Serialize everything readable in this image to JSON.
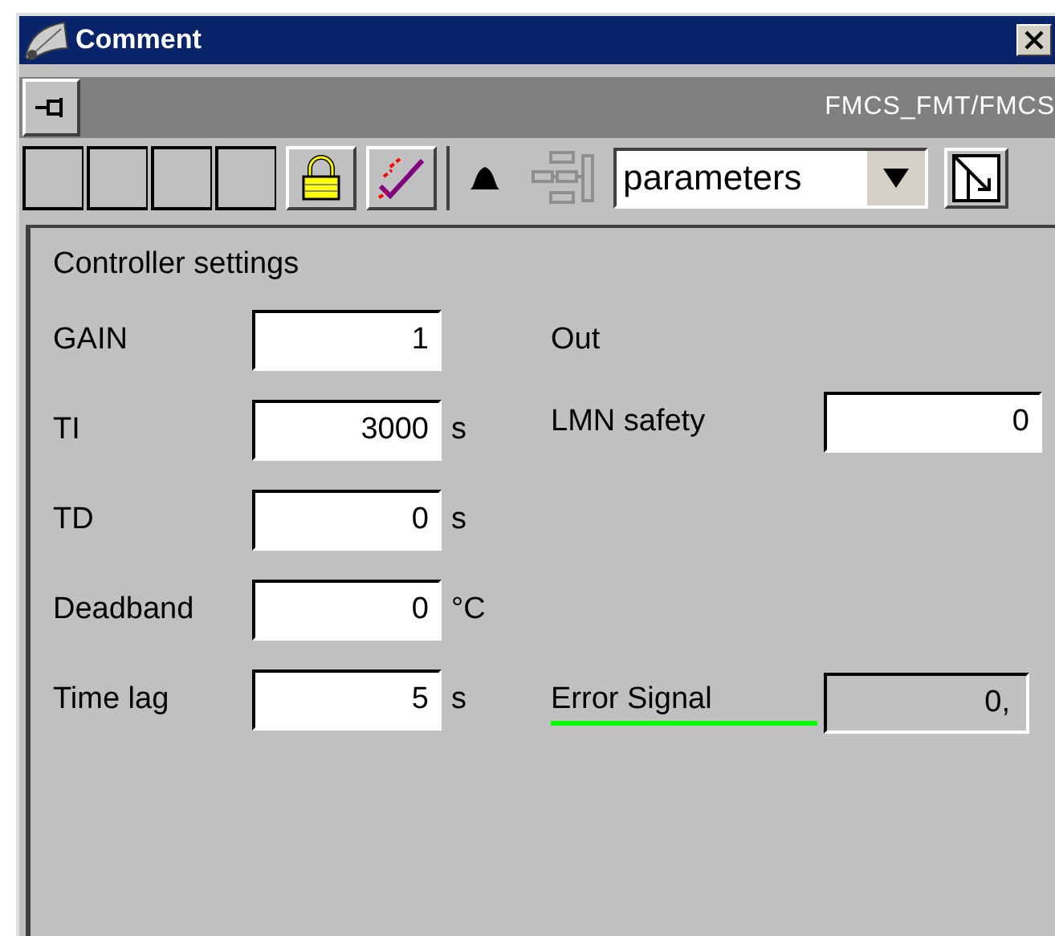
{
  "window": {
    "title": "Comment"
  },
  "header": {
    "path": "FMCS_FMT/FMCS"
  },
  "toolbar": [
    {
      "kind": "blank"
    },
    {
      "kind": "blank"
    },
    {
      "kind": "blank"
    },
    {
      "kind": "blank"
    },
    {
      "kind": "lock"
    },
    {
      "kind": "check"
    },
    {
      "kind": "bell"
    },
    {
      "kind": "diagram",
      "disabled": true
    }
  ],
  "view_select": {
    "value": "parameters"
  },
  "section": {
    "title": "Controller settings"
  },
  "parameters": [
    {
      "label": "GAIN",
      "value": "1"
    },
    {
      "label": "TI",
      "value": "3000",
      "unit": "s"
    },
    {
      "label": "TD",
      "value": "0",
      "unit": "s"
    },
    {
      "label": "Deadband",
      "value": "0",
      "unit": "°C"
    },
    {
      "label": "Time lag",
      "value": "5",
      "unit": "s"
    }
  ],
  "outputs": [
    {
      "kind": "heading",
      "label": "Out"
    },
    {
      "kind": "input",
      "label": "LMN safety",
      "value": "0"
    },
    {
      "kind": "spacer"
    },
    {
      "kind": "spacer"
    },
    {
      "kind": "readout",
      "label": "Error Signal",
      "value": "0,"
    }
  ]
}
